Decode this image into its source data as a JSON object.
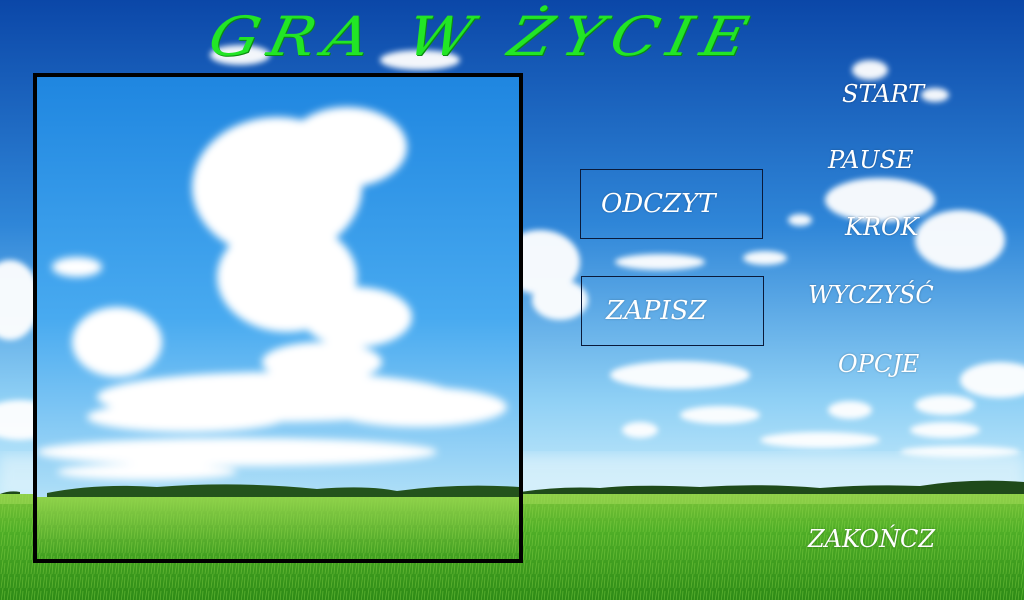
{
  "title": "GRA W ŻYCIE",
  "buttons": {
    "read": "ODCZYT",
    "save": "ZAPISZ"
  },
  "menu": {
    "start": "START",
    "pause": "PAUSE",
    "step": "KROK",
    "clear": "WYCZYŚĆ",
    "options": "OPCJE",
    "quit": "ZAKOŃCZ"
  },
  "colors": {
    "title": "#22e626",
    "text": "#ffffff",
    "sky_top": "#0b47a8",
    "sky_bottom": "#8fd0f5",
    "grass": "#3fa51f",
    "board_border": "#000000"
  }
}
